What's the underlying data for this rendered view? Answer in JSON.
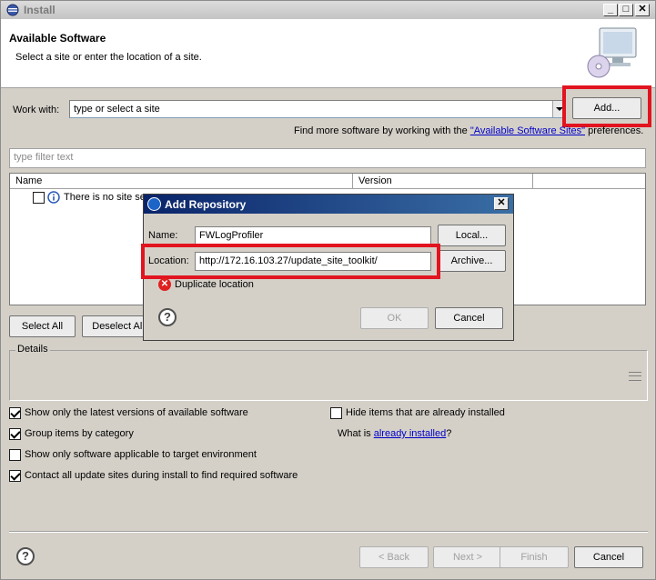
{
  "window": {
    "title": "Install",
    "controls": {
      "minimize": "_",
      "maximize": "□",
      "close": "✕"
    }
  },
  "banner": {
    "title": "Available Software",
    "description": "Select a site or enter the location of a site."
  },
  "work_with": {
    "label": "Work with:",
    "value": "type or select a site",
    "add_button": "Add..."
  },
  "find_more": {
    "prefix": "Find more software by working with the ",
    "link": "\"Available Software Sites\"",
    "suffix": " preferences."
  },
  "filter": {
    "placeholder": "type filter text"
  },
  "table": {
    "columns": [
      "Name",
      "Version"
    ],
    "row_text": "There is no site se"
  },
  "buttons": {
    "select_all": "Select All",
    "deselect_all": "Deselect All"
  },
  "details": {
    "label": "Details"
  },
  "options": {
    "show_latest": {
      "label": "Show only the latest versions of available software",
      "checked": true
    },
    "group_by_category": {
      "label": "Group items by category",
      "checked": true
    },
    "show_applicable": {
      "label": "Show only software applicable to target environment",
      "checked": false
    },
    "contact_sites": {
      "label": "Contact all update sites during install to find required software",
      "checked": true
    },
    "hide_installed": {
      "label": "Hide items that are already installed",
      "checked": false
    },
    "what_is_prefix": "What is ",
    "already_installed_link": "already installed",
    "what_is_suffix": "?"
  },
  "footer": {
    "back": "< Back",
    "next": "Next >",
    "finish": "Finish",
    "cancel": "Cancel"
  },
  "dialog": {
    "title": "Add Repository",
    "close": "✕",
    "name_label": "Name:",
    "name_value": "FWLogProfiler",
    "local_button": "Local...",
    "location_label": "Location:",
    "location_value": "http://172.16.103.27/update_site_toolkit/",
    "archive_button": "Archive...",
    "error_text": "Duplicate location",
    "ok_button": "OK",
    "cancel_button": "Cancel"
  },
  "colors": {
    "highlight": "#e1141f",
    "dialog_title": "#0a246a",
    "link": "#0000c8"
  }
}
